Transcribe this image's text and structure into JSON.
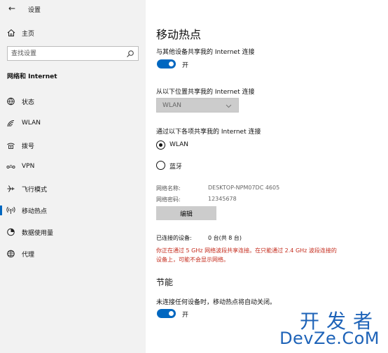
{
  "window": {
    "app_title": "设置",
    "back_glyph": "←"
  },
  "sidebar": {
    "home_label": "主页",
    "search_placeholder": "查找设置",
    "section_title": "网络和 Internet",
    "items": [
      {
        "label": "状态",
        "icon": "globe-icon"
      },
      {
        "label": "WLAN",
        "icon": "wifi-icon"
      },
      {
        "label": "拨号",
        "icon": "dialup-icon"
      },
      {
        "label": "VPN",
        "icon": "vpn-icon"
      },
      {
        "label": "飞行模式",
        "icon": "airplane-icon"
      },
      {
        "label": "移动热点",
        "icon": "hotspot-icon",
        "active": true
      },
      {
        "label": "数据使用量",
        "icon": "data-usage-icon"
      },
      {
        "label": "代理",
        "icon": "proxy-globe-icon"
      }
    ]
  },
  "main": {
    "title": "移动热点",
    "share_label": "与其他设备共享我的 Internet 连接",
    "share_toggle": {
      "state": "开",
      "on": true
    },
    "source_label": "从以下位置共享我的 Internet 连接",
    "source_dropdown": "WLAN",
    "share_via_label": "通过以下各项共享我的 Internet 连接",
    "share_via_options": [
      {
        "label": "WLAN",
        "checked": true
      },
      {
        "label": "蓝牙",
        "checked": false
      }
    ],
    "network_name_label": "网络名称:",
    "network_name_value": "DESKTOP-NPM07DC 4605",
    "network_password_label": "网络密码:",
    "network_password_value": "12345678",
    "edit_button": "编辑",
    "connected_label": "已连接的设备:",
    "connected_value": "0 台(共 8 台)",
    "warning_line1": "你正在通过 5 GHz 网络波段共享连接。在只能通过 2.4 GHz 波段连接的",
    "warning_line2": "设备上，可能不会显示网络。",
    "power_section_title": "节能",
    "power_label": "未连接任何设备时，移动热点将自动关闭。",
    "power_toggle": {
      "state": "开",
      "on": true
    },
    "accent_color": "#0067c0",
    "warning_color": "#c42b1c"
  },
  "watermark": {
    "line1": "开发者",
    "line2": "DevZe.CoM"
  }
}
